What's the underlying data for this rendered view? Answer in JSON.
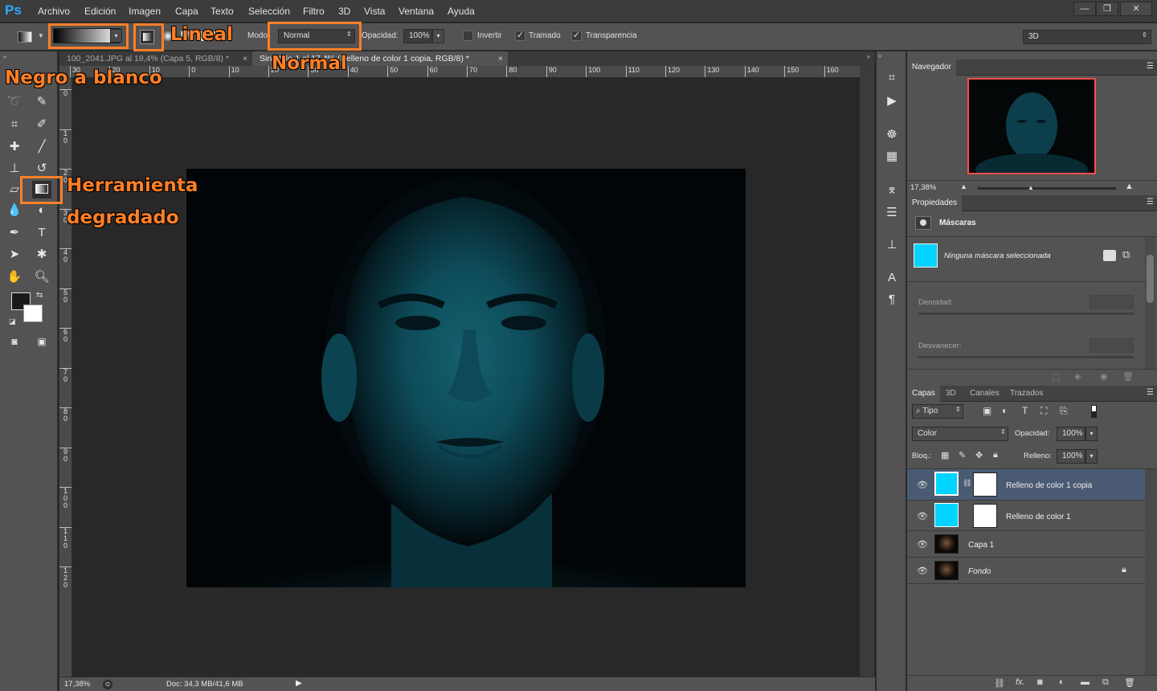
{
  "app": {
    "logo": "Ps"
  },
  "menu": [
    "Archivo",
    "Edición",
    "Imagen",
    "Capa",
    "Texto",
    "Selección",
    "Filtro",
    "3D",
    "Vista",
    "Ventana",
    "Ayuda"
  ],
  "window_controls": {
    "minimize": "—",
    "restore": "❐",
    "close": "✕"
  },
  "options": {
    "gradient_preset": "Negro a blanco",
    "gradient_type": "Lineal",
    "mode_label": "Modo:",
    "mode_value": "Normal",
    "opacity_label": "Opacidad:",
    "opacity_value": "100%",
    "invert_label": "Invertir",
    "invert_checked": false,
    "dither_label": "Tramado",
    "dither_checked": true,
    "transparency_label": "Transparencia",
    "transparency_checked": true,
    "workspace_value": "3D"
  },
  "doc_tabs": [
    {
      "label": "100_2041.JPG al 18,4% (Capa 5, RGB/8) *",
      "active": false
    },
    {
      "label": "Sin título-1 al 17,4% (Relleno de color 1 copia, RGB/8) *",
      "active": true
    }
  ],
  "ruler": {
    "h_ticks": [
      "30",
      "20",
      "10",
      "0",
      "10",
      "20",
      "30",
      "40",
      "50",
      "60",
      "70",
      "80",
      "90",
      "100",
      "110",
      "120",
      "130",
      "140",
      "150",
      "160"
    ],
    "v_ticks": [
      "0",
      "1 0",
      "2 0",
      "3 0",
      "4 0",
      "5 0",
      "6 0",
      "7 0",
      "8 0",
      "9 0",
      "1 0 0",
      "1 1 0",
      "1 2 0"
    ]
  },
  "status": {
    "zoom": "17,38%",
    "doc": "Doc: 34,3 MB/41,6 MB"
  },
  "navigator": {
    "title": "Navegador",
    "zoom": "17,38%"
  },
  "properties": {
    "title": "Propiedades",
    "section": "Máscaras",
    "no_mask": "Ninguna máscara seleccionada",
    "density_label": "Densidad:",
    "feather_label": "Desvanecer:"
  },
  "layers_panel": {
    "tabs": [
      "Capas",
      "3D",
      "Canales",
      "Trazados"
    ],
    "filter_kind": "Tipo",
    "blend_mode": "Color",
    "opacity_label": "Opacidad:",
    "opacity_value": "100%",
    "lock_label": "Bloq.:",
    "fill_label": "Relleno:",
    "fill_value": "100%",
    "layers": [
      {
        "name": "Relleno de color 1 copia",
        "kind": "fill",
        "selected": true,
        "visible": true
      },
      {
        "name": "Relleno de color 1",
        "kind": "fill",
        "selected": false,
        "visible": true
      },
      {
        "name": "Capa 1",
        "kind": "image",
        "selected": false,
        "visible": true
      },
      {
        "name": "Fondo",
        "kind": "image",
        "selected": false,
        "visible": true,
        "locked": true
      }
    ]
  },
  "annotations": {
    "gradient_preset": "Negro a blanco",
    "linear": "Lineal",
    "normal": "Normal",
    "tool_line1": "Herramienta",
    "tool_line2": "degradado"
  },
  "colors": {
    "accent": "#ff7f27",
    "fill_layer": "#00d4ff",
    "photo_tint": "#0e4c5c",
    "navigator_frame": "#ff4c4c",
    "selected_row": "#4b5a73"
  }
}
